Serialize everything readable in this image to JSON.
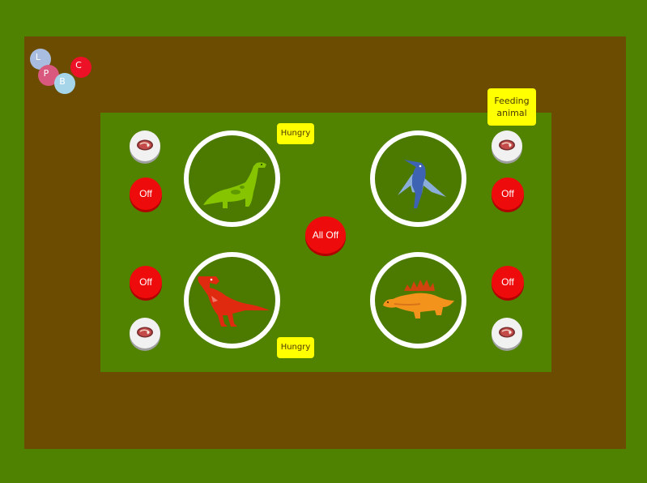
{
  "legend_balls": [
    {
      "label": "L",
      "color": "#a9bde0"
    },
    {
      "label": "P",
      "color": "#d9587d"
    },
    {
      "label": "B",
      "color": "#a6d5ea"
    },
    {
      "label": "C",
      "color": "#ec1127"
    }
  ],
  "pens": {
    "top_left": {
      "animal": "brachiosaurus",
      "status": "Hungry",
      "off_label": "Off",
      "feed_icon": "meat-icon"
    },
    "top_right": {
      "animal": "pterodactyl",
      "status": "Feeding animal",
      "off_label": "Off",
      "feed_icon": "meat-icon"
    },
    "bottom_left": {
      "animal": "t-rex",
      "status": "",
      "off_label": "Off",
      "feed_icon": "meat-icon"
    },
    "bottom_right": {
      "animal": "stegosaurus",
      "status": "Hungry",
      "off_label": "Off",
      "feed_icon": "meat-icon"
    }
  },
  "all_off_label": "All Off",
  "colors": {
    "background": "#4f8200",
    "dirt_frame": "#6b4c00",
    "field": "#528300",
    "off_button": "#ee0b0b",
    "status_tag": "#ffff00"
  }
}
